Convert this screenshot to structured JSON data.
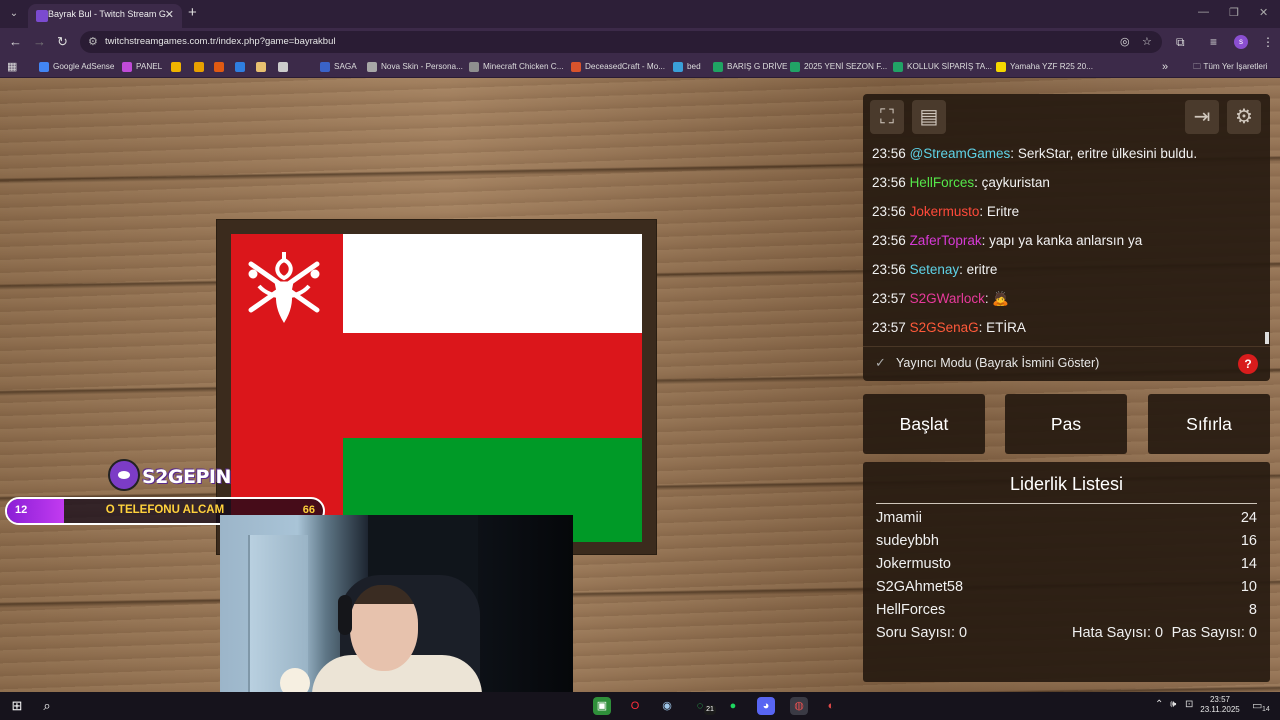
{
  "browser": {
    "tab_title": "Bayrak Bul - Twitch Stream Games",
    "tab_close": "✕",
    "new_tab": "+",
    "url": "twitchstreamgames.com.tr/index.php?game=bayrakbul",
    "profile_initial": "s"
  },
  "bookmarks": {
    "items": [
      {
        "label": "Google AdSense",
        "color": "#4285f4"
      },
      {
        "label": "PANEL",
        "color": "#c04bd8"
      },
      {
        "label": "",
        "color": "#f0b400"
      },
      {
        "label": "",
        "color": "#e8a000"
      },
      {
        "label": "",
        "color": "#e05a12"
      },
      {
        "label": "",
        "color": "#2f7fe0"
      },
      {
        "label": "",
        "color": "#e8c070"
      },
      {
        "label": "",
        "color": "#cccccc"
      },
      {
        "label": "SAGA",
        "color": "#3a63c8"
      },
      {
        "label": "Nova Skin - Persona...",
        "color": "#a7a7a7"
      },
      {
        "label": "Minecraft Chicken C...",
        "color": "#8f8f8f"
      },
      {
        "label": "DeceasedCraft - Mo...",
        "color": "#d9532c"
      },
      {
        "label": "bed",
        "color": "#3aa0d8"
      },
      {
        "label": "BARIŞ G DRİVE",
        "color": "#1fa463"
      },
      {
        "label": "2025 YENİ SEZON F...",
        "color": "#21a366"
      },
      {
        "label": "KOLLUK SİPARİŞ TA...",
        "color": "#21a366"
      },
      {
        "label": "Yamaha YZF R25 20...",
        "color": "#f5d800"
      }
    ],
    "more": "»",
    "all_bookmarks": "Tüm Yer İşaretleri"
  },
  "overlay": {
    "brand": "S2GEPIN",
    "goal": {
      "current": "12",
      "label": "O TELEFONU ALCAM",
      "target": "66",
      "progress": 0.18
    }
  },
  "chat": {
    "messages": [
      {
        "time": "23:56",
        "user": "@StreamGames",
        "color": "#5fd3e8",
        "text": "SerkStar, eritre ülkesini buldu."
      },
      {
        "time": "23:56",
        "user": "HellForces",
        "color": "#55e64a",
        "text": "çaykuristan"
      },
      {
        "time": "23:56",
        "user": "Jokermusto",
        "color": "#ff4a3a",
        "text": "Eritre"
      },
      {
        "time": "23:56",
        "user": "ZaferToprak",
        "color": "#d63ad6",
        "text": "yapı ya kanka anlarsın ya"
      },
      {
        "time": "23:56",
        "user": "Setenay",
        "color": "#5fd3e8",
        "text": "eritre"
      },
      {
        "time": "23:57",
        "user": "S2GWarlock",
        "color": "#e83a9c",
        "text": "🙇"
      },
      {
        "time": "23:57",
        "user": "S2GSenaG",
        "color": "#ff5a3a",
        "text": "ETİRA"
      }
    ],
    "streamer_mode": "Yayıncı Modu (Bayrak İsmini Göster)",
    "help": "?"
  },
  "controls": {
    "start": "Başlat",
    "pass": "Pas",
    "reset": "Sıfırla"
  },
  "leaderboard": {
    "title": "Liderlik Listesi",
    "rows": [
      {
        "name": "Jmamii",
        "score": "24"
      },
      {
        "name": "sudeybbh",
        "score": "16"
      },
      {
        "name": "Jokermusto",
        "score": "14"
      },
      {
        "name": "S2GAhmet58",
        "score": "10"
      },
      {
        "name": "HellForces",
        "score": "8"
      }
    ],
    "questions": "Soru Sayısı: 0",
    "errors": "Hata Sayısı: 0",
    "passes": "Pas Sayısı: 0"
  },
  "flag": {
    "white": "#ffffff",
    "red": "#db161b",
    "green": "#009a27",
    "emblem_color": "#ffffff"
  },
  "taskbar": {
    "time": "23:57",
    "date": "23.11.2025",
    "badge": "21",
    "notif": "14"
  }
}
